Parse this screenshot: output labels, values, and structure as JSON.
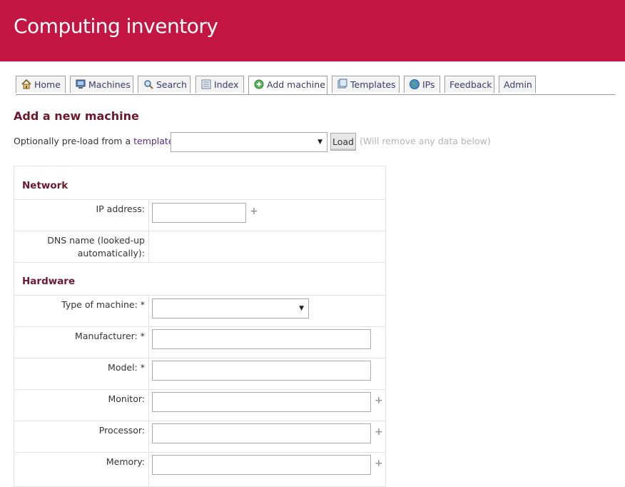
{
  "app": {
    "title": "Computing inventory"
  },
  "tabs": [
    {
      "label": "Home",
      "icon": "home-icon"
    },
    {
      "label": "Machines",
      "icon": "computer-icon"
    },
    {
      "label": "Search",
      "icon": "magnifier-icon"
    },
    {
      "label": "Index",
      "icon": "list-icon"
    },
    {
      "label": "Add machine",
      "icon": "add-icon",
      "active": true
    },
    {
      "label": "Templates",
      "icon": "templates-icon"
    },
    {
      "label": "IPs",
      "icon": "globe-icon"
    },
    {
      "label": "Feedback"
    },
    {
      "label": "Admin"
    }
  ],
  "page": {
    "title": "Add a new machine",
    "preload_prefix": "Optionally pre-load from a ",
    "preload_link": "template",
    "preload_suffix": ":",
    "template_select_value": "",
    "load_label": "Load",
    "load_note": "(Will remove any data below)"
  },
  "form": {
    "network_heading": "Network",
    "ip_label": "IP address:",
    "ip_value": "",
    "dns_label_line1": "DNS name (looked-up",
    "dns_label_line2": "automatically):",
    "hardware_heading": "Hardware",
    "type_label": "Type of machine: *",
    "type_value": "",
    "manufacturer_label": "Manufacturer: *",
    "model_label": "Model: *",
    "monitor_label": "Monitor:",
    "processor_label": "Processor:",
    "memory_label": "Memory:",
    "plus_symbol": "+"
  },
  "colors": {
    "header": "#c31643",
    "heading": "#6b1830",
    "link": "#5a2a8a"
  }
}
